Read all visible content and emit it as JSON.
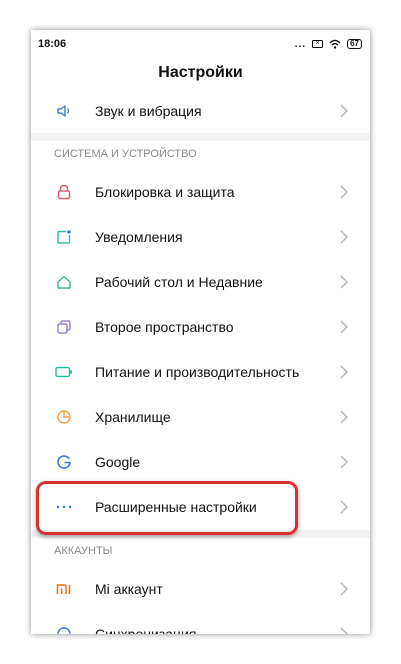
{
  "status_bar": {
    "time": "18:06",
    "dots": "...",
    "battery": "67"
  },
  "header": {
    "title": "Настройки"
  },
  "rows_top": [
    {
      "label": "Звук и вибрация",
      "icon": "speaker-icon"
    }
  ],
  "section_system": {
    "title": "СИСТЕМА И УСТРОЙСТВО"
  },
  "rows_system": [
    {
      "label": "Блокировка и защита",
      "icon": "lock-icon"
    },
    {
      "label": "Уведомления",
      "icon": "notification-icon"
    },
    {
      "label": "Рабочий стол и Недавние",
      "icon": "home-icon"
    },
    {
      "label": "Второе пространство",
      "icon": "second-space-icon"
    },
    {
      "label": "Питание и производительность",
      "icon": "battery-icon"
    },
    {
      "label": "Хранилище",
      "icon": "storage-pie-icon"
    },
    {
      "label": "Google",
      "icon": "google-icon"
    },
    {
      "label": "Расширенные настройки",
      "icon": "more-dots-icon"
    }
  ],
  "section_accounts": {
    "title": "АККАУНТЫ"
  },
  "rows_accounts": [
    {
      "label": "Mi аккаунт",
      "icon": "mi-logo-icon"
    },
    {
      "label": "Синхронизация",
      "icon": "sync-icon"
    }
  ],
  "colors": {
    "accent_blue": "#3a7bd5",
    "lock_red": "#e05c6a",
    "home_green": "#3dbb8a",
    "space_purple": "#8a6fd1",
    "battery_green": "#2fb9a4",
    "storage_orange": "#f2a03d",
    "mi_orange": "#ff6a00",
    "highlight_red": "#d93030"
  }
}
